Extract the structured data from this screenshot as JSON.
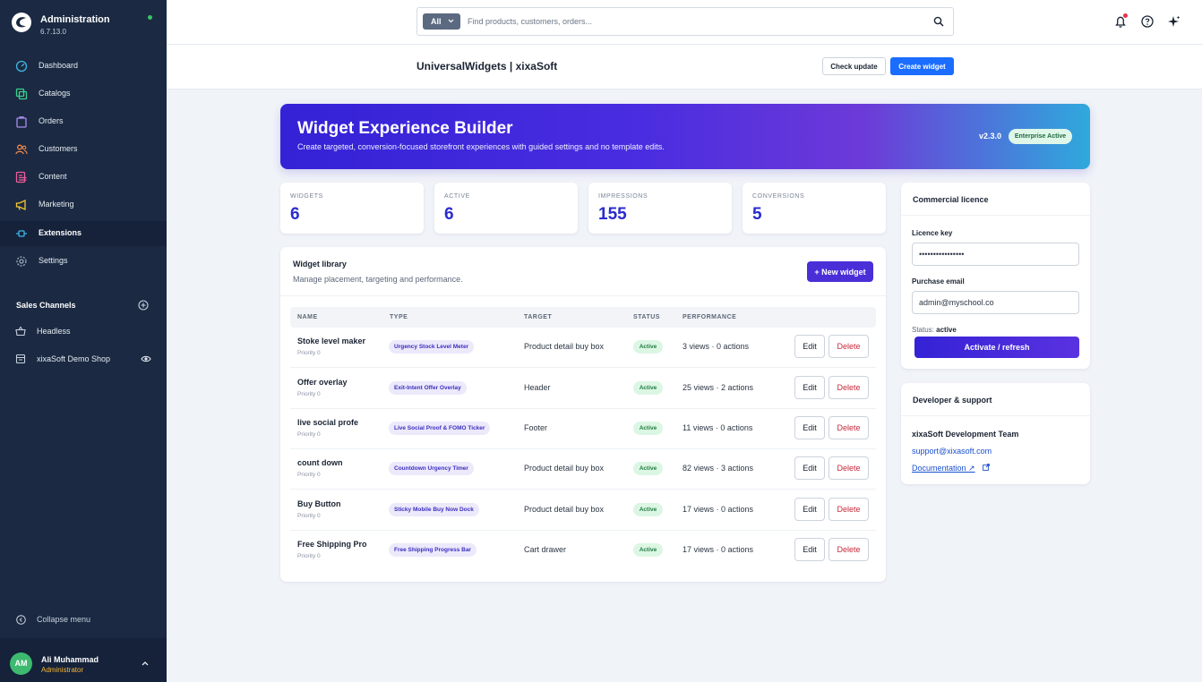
{
  "app": {
    "title": "Administration",
    "version": "6.7.13.0"
  },
  "sidebar": {
    "items": [
      {
        "label": "Dashboard",
        "icon": "gauge-icon"
      },
      {
        "label": "Catalogs",
        "icon": "catalog-icon"
      },
      {
        "label": "Orders",
        "icon": "bag-icon"
      },
      {
        "label": "Customers",
        "icon": "users-icon"
      },
      {
        "label": "Content",
        "icon": "content-icon"
      },
      {
        "label": "Marketing",
        "icon": "megaphone-icon"
      },
      {
        "label": "Extensions",
        "icon": "plug-icon",
        "active": true
      },
      {
        "label": "Settings",
        "icon": "gear-icon"
      }
    ],
    "sales_channels_title": "Sales Channels",
    "channels": [
      {
        "label": "Headless",
        "icon": "basket-icon"
      },
      {
        "label": "xixaSoft Demo Shop",
        "icon": "storefront-icon"
      }
    ],
    "collapse_label": "Collapse menu",
    "user": {
      "initials": "AM",
      "name": "Ali Muhammad",
      "role": "Administrator"
    }
  },
  "topbar": {
    "search_scope": "All",
    "search_placeholder": "Find products, customers, orders..."
  },
  "page": {
    "title": "UniversalWidgets | xixaSoft",
    "check_update_label": "Check update",
    "create_widget_label": "Create widget"
  },
  "hero": {
    "title": "Widget Experience Builder",
    "subtitle": "Create targeted, conversion-focused storefront experiences with guided settings and no template edits.",
    "version": "v2.3.0",
    "badge": "Enterprise Active"
  },
  "stats": [
    {
      "label": "WIDGETS",
      "value": "6"
    },
    {
      "label": "ACTIVE",
      "value": "6"
    },
    {
      "label": "IMPRESSIONS",
      "value": "155"
    },
    {
      "label": "CONVERSIONS",
      "value": "5"
    }
  ],
  "library": {
    "title": "Widget library",
    "subtitle": "Manage placement, targeting and performance.",
    "new_button": "+ New widget",
    "columns": [
      "NAME",
      "TYPE",
      "TARGET",
      "STATUS",
      "PERFORMANCE"
    ],
    "edit_label": "Edit",
    "delete_label": "Delete",
    "rows": [
      {
        "name": "Stoke level maker",
        "priority": "Priority 0",
        "type": "Urgency Stock Level Meter",
        "target": "Product detail buy box",
        "status": "Active",
        "performance": "3 views · 0 actions"
      },
      {
        "name": "Offer overlay",
        "priority": "Priority 0",
        "type": "Exit-Intent Offer Overlay",
        "target": "Header",
        "status": "Active",
        "performance": "25 views · 2 actions"
      },
      {
        "name": "live social profe",
        "priority": "Priority 0",
        "type": "Live Social Proof & FOMO Ticker",
        "target": "Footer",
        "status": "Active",
        "performance": "11 views · 0 actions"
      },
      {
        "name": "count down",
        "priority": "Priority 0",
        "type": "Countdown Urgency Timer",
        "target": "Product detail buy box",
        "status": "Active",
        "performance": "82 views · 3 actions"
      },
      {
        "name": "Buy Button",
        "priority": "Priority 0",
        "type": "Sticky Mobile Buy Now Dock",
        "target": "Product detail buy box",
        "status": "Active",
        "performance": "17 views · 0 actions"
      },
      {
        "name": "Free Shipping Pro",
        "priority": "Priority 0",
        "type": "Free Shipping Progress Bar",
        "target": "Cart drawer",
        "status": "Active",
        "performance": "17 views · 0 actions"
      }
    ]
  },
  "licence": {
    "title": "Commercial licence",
    "key_label": "Licence key",
    "key_value": "••••••••••••••••",
    "email_label": "Purchase email",
    "email_value": "admin@myschool.co",
    "status_prefix": "Status:",
    "status_value": "active",
    "activate_label": "Activate / refresh"
  },
  "support": {
    "title": "Developer & support",
    "team": "xixaSoft Development Team",
    "email": "support@xixasoft.com",
    "docs_label": "Documentation ↗"
  },
  "colors": {
    "sidebar_bg": "#1b2a42",
    "accent_blue": "#1a6dff",
    "accent_purple": "#4a2fd8",
    "success": "#1f7a42",
    "danger": "#c7293b"
  }
}
